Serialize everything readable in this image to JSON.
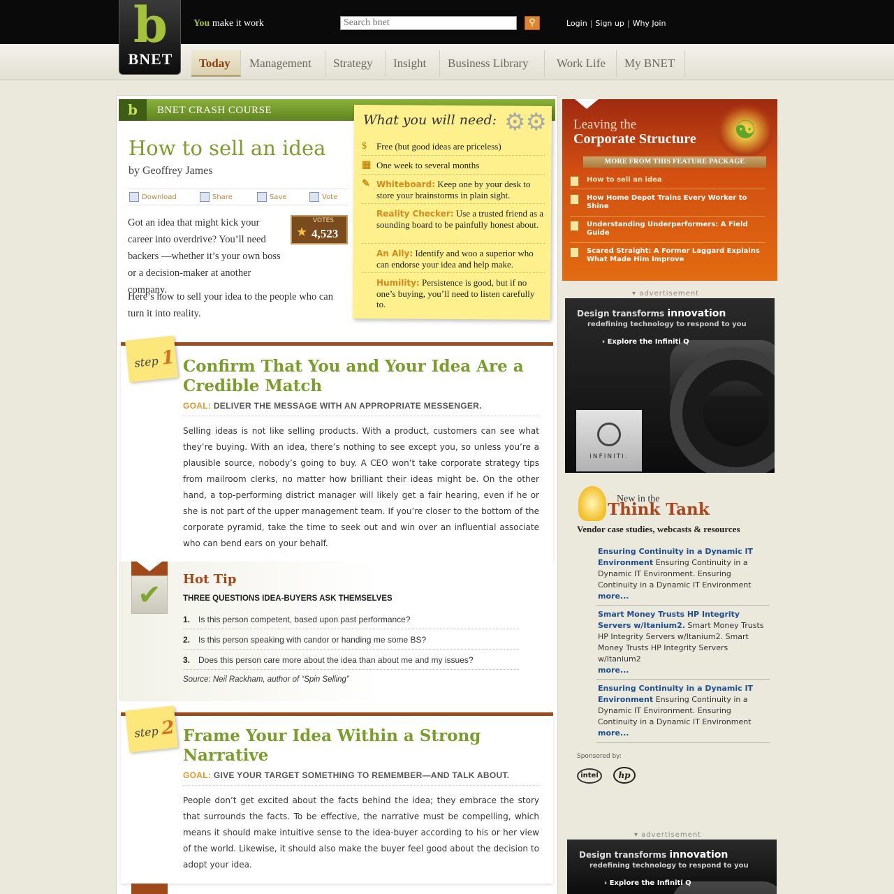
{
  "header": {
    "logo_letter": "b",
    "logo_text": "BNET",
    "tagline_strong": "You",
    "tagline_rest": "make it work",
    "search_placeholder": "Search bnet",
    "search_icon": "search-icon",
    "auth_links": [
      "Login",
      "Sign up",
      "Why Join"
    ]
  },
  "nav": {
    "tabs": [
      "Today",
      "Management",
      "Strategy",
      "Insight",
      "Business Library",
      "Work Life",
      "My BNET"
    ],
    "active": "Today"
  },
  "article": {
    "section_label": "BNET CRASH COURSE",
    "section_letter": "b",
    "title": "How to sell an idea",
    "byline": "by Geoffrey James",
    "tools": [
      "Download",
      "Share",
      "Save",
      "Vote"
    ],
    "votes_label": "VOTES",
    "votes_count": "4,523",
    "intro": [
      "Got an idea that might kick your career into overdrive?  You’ll need backers —whether it’s your own boss or a decision-maker at another company.",
      "Here’s how to sell your idea to the people who can turn it into reality."
    ]
  },
  "needs": {
    "title": "What you will need:",
    "items": [
      {
        "label": "",
        "text": "Free (but good ideas are priceless)",
        "icon": "dollar-icon"
      },
      {
        "label": "",
        "text": "One week to several months",
        "icon": "calendar-icon"
      },
      {
        "label": "Whiteboard:",
        "text": "Keep one by your desk to store your brainstorms in plain sight.",
        "icon": "marker-icon"
      },
      {
        "label": "Reality Checker:",
        "text": "Use a trusted friend as a sounding board to be painfully honest about.",
        "icon": ""
      },
      {
        "label": "An Ally:",
        "text": "Identify and woo a superior who can endorse your idea and help make.",
        "icon": ""
      },
      {
        "label": "Humility:",
        "text": "Persistence is good, but if no one’s buying, you’ll need to listen carefully to.",
        "icon": ""
      }
    ]
  },
  "steps": [
    {
      "word": "step",
      "number": "1",
      "title": "Confirm That  You and Your Idea Are a Credible Match",
      "goal_label": "GOAL:",
      "goal": "DELIVER THE MESSAGE WITH AN APPROPRIATE MESSENGER.",
      "text": "Selling ideas is not like selling products.  With a product, customers can see what they’re buying.  With an idea, there’s nothing to see except you, so unless you’re a plausible source, nobody’s going to buy.  A CEO won’t take corporate strategy tips from mailroom clerks, no matter how brilliant their ideas might be.  On the other hand, a top-performing district manager will likely get a fair hearing, even if he or she is not part of the upper management team.  If you’re closer to the bottom of the corporate pyramid, take the time to seek out and win over an influential associate who can bend ears on your behalf."
    },
    {
      "word": "step",
      "number": "2",
      "title": "Frame Your Idea Within a Strong Narrative",
      "goal_label": "GOAL:",
      "goal": "GIVE YOUR TARGET SOMETHING TO REMEMBER—AND TALK ABOUT.",
      "text": "People don’t get excited about the facts behind the idea; they embrace the story that surrounds the facts.  To be effective, the narrative must be compelling, which means it should make intuitive sense to the idea-buyer according to his or her view of the world. Likewise, it should also make the buyer feel good about the decision to adopt your idea."
    }
  ],
  "hot_tip": {
    "title": "Hot Tip",
    "subtitle": "THREE QUESTIONS IDEA-BUYERS ASK THEMSELVES",
    "items": [
      {
        "n": "1.",
        "text": "Is this person competent, based upon past performance?"
      },
      {
        "n": "2.",
        "text": "Is this person speaking with candor or handing me some BS?"
      },
      {
        "n": "3.",
        "text": "Does this person care more about the idea than about me and my issues?"
      }
    ],
    "source": "Source: Neil Rackham, author of “Spin Selling”"
  },
  "feature": {
    "title_line1": "Leaving the",
    "title_line2": "Corporate Structure",
    "more_label": "MORE FROM THIS FEATURE PACKAGE",
    "items": [
      "How to sell an idea",
      "How Home Depot Trains Every Worker to Shine",
      "Understanding Underperformers: A Field Guide",
      "Scared Straight: A Former Laggard Explains What Made Him Improve"
    ]
  },
  "ads": {
    "label": "advertisement",
    "headline_pre": "Design transforms",
    "headline_em": "innovation",
    "sub": "redefining technology to respond to you",
    "cta": "› Explore the Infiniti Q",
    "brand": "INFINITI."
  },
  "think_tank": {
    "new_in": "New in the",
    "title": "Think Tank",
    "subtitle": "Vendor case studies, webcasts & resources",
    "items": [
      {
        "link": "Ensuring Continuity in a Dynamic IT Environment",
        "text": "Ensuring Continuity in a Dynamic IT Environment. Ensuring Continuity in a Dynamic IT Environment",
        "more": "more..."
      },
      {
        "link": "Smart Money Trusts HP Integrity Servers w/Itanium2.",
        "text": "Smart Money Trusts HP Integrity Servers w/Itanium2. Smart Money Trusts HP Integrity Servers w/Itanium2",
        "more": "more..."
      },
      {
        "link": "Ensuring Continuity in a Dynamic IT Environment",
        "text": "Ensuring Continuity in a Dynamic IT Environment. Ensuring Continuity in a Dynamic IT Environment",
        "more": "more..."
      }
    ],
    "sponsored_by": "Sponsored by:",
    "sponsors": [
      "intel",
      "hp"
    ]
  },
  "colors": {
    "accent_green": "#7a9e2a",
    "accent_orange": "#d24f11",
    "link_blue": "#1c4e93"
  }
}
